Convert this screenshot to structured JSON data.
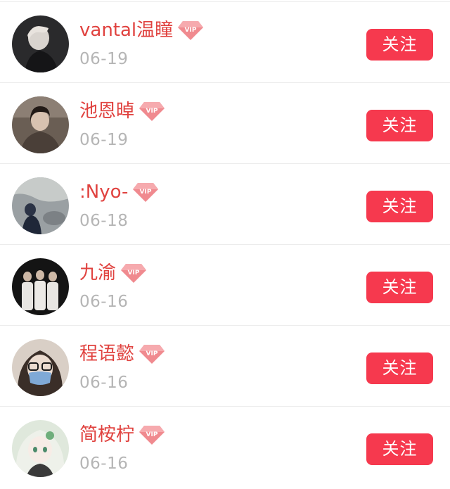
{
  "colors": {
    "name": "#e0423f",
    "date": "#b5b5b5",
    "button_bg": "#f6394e",
    "button_text": "#ffffff",
    "divider": "#ececec",
    "vip_badge": "#f08a8f"
  },
  "users": [
    {
      "name": "vantal温瞳",
      "date": "06-19",
      "badge_icon": "vip-diamond-icon",
      "badge_text": "VIP",
      "follow_label": "关注"
    },
    {
      "name": "池恩晫",
      "date": "06-19",
      "badge_icon": "vip-diamond-icon",
      "badge_text": "VIP",
      "follow_label": "关注"
    },
    {
      "name": ":Nyo-",
      "date": "06-18",
      "badge_icon": "vip-diamond-icon",
      "badge_text": "VIP",
      "follow_label": "关注"
    },
    {
      "name": "九渝",
      "date": "06-16",
      "badge_icon": "vip-diamond-icon",
      "badge_text": "VIP",
      "follow_label": "关注"
    },
    {
      "name": "程语懿",
      "date": "06-16",
      "badge_icon": "vip-diamond-icon",
      "badge_text": "VIP",
      "follow_label": "关注"
    },
    {
      "name": "简桉柠",
      "date": "06-16",
      "badge_icon": "vip-diamond-icon",
      "badge_text": "VIP",
      "follow_label": "关注"
    }
  ]
}
